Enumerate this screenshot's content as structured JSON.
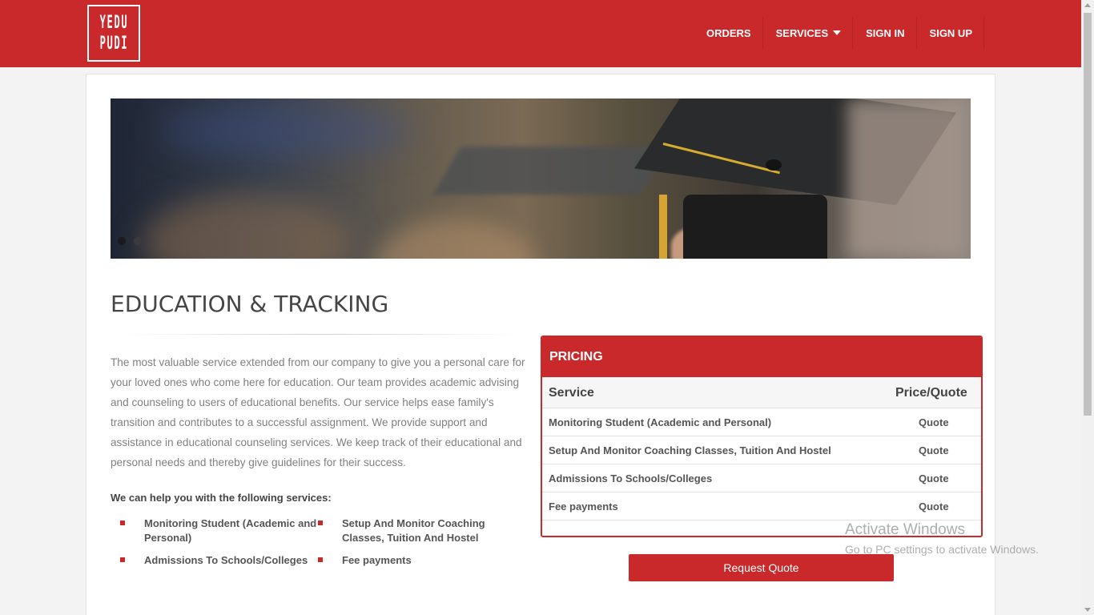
{
  "logo": {
    "rows": [
      "YEDU",
      "PUDI"
    ]
  },
  "nav": {
    "items": [
      {
        "label": "ORDERS"
      },
      {
        "label": "SERVICES"
      },
      {
        "label": "SIGN IN"
      },
      {
        "label": "SIGN UP"
      }
    ]
  },
  "hero": {
    "slide_count": 2,
    "active_slide": 1
  },
  "page": {
    "title": "EDUCATION & TRACKING",
    "description": "The most valuable service extended from our company to give you a personal care for your loved ones who come here for education. Our team provides academic advising and counseling to users of educational benefits. Our service helps ease family's transition and contributes to a successful assignment. We provide support and assistance in educational counseling services. We keep track of their educational and personal needs and thereby give guidelines for their success.",
    "help_heading": "We can help you with the following services:",
    "services": [
      "Monitoring Student (Academic and Personal)",
      "Setup And Monitor Coaching Classes, Tuition And Hostel",
      "Admissions To Schools/Colleges",
      "Fee payments"
    ]
  },
  "pricing": {
    "heading": "PRICING",
    "columns": [
      "Service",
      "Price/Quote"
    ],
    "rows": [
      {
        "service": "Monitoring Student (Academic and Personal)",
        "price": "Quote"
      },
      {
        "service": "Setup And Monitor Coaching Classes, Tuition And Hostel",
        "price": "Quote"
      },
      {
        "service": "Admissions To Schools/Colleges",
        "price": "Quote"
      },
      {
        "service": "Fee payments",
        "price": "Quote"
      }
    ],
    "button_label": "Request Quote"
  },
  "watermark": {
    "line1": "Activate Windows",
    "line2": "Go to PC settings to activate Windows."
  },
  "colors": {
    "brand": "#c9292a",
    "heading": "#454545",
    "body_text": "#808080"
  }
}
